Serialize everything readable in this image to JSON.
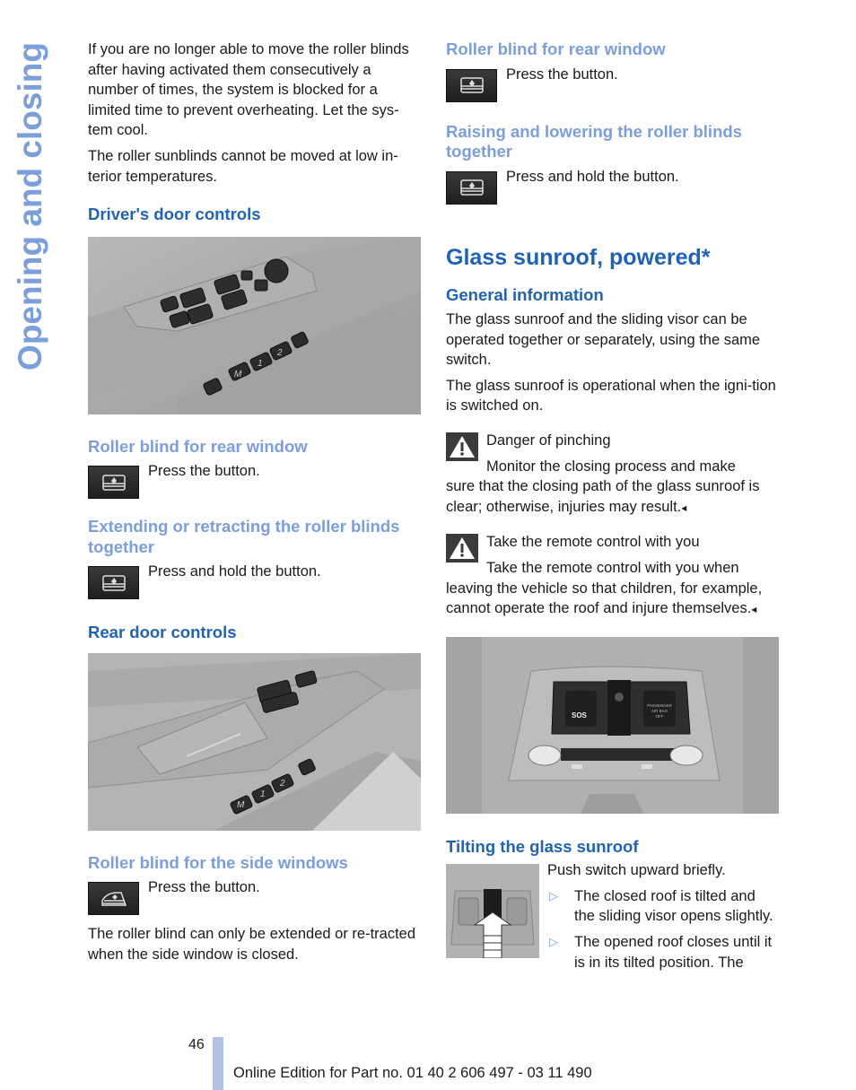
{
  "sidebar": {
    "chapter_title": "Opening and closing"
  },
  "left_column": {
    "intro_paragraphs": [
      "If you are no longer able to move the roller blinds after having activated them consecutively a number of times, the system is blocked for a limited time to prevent overheating. Let the sys-tem cool.",
      "The roller sunblinds cannot be moved at low in-terior temperatures."
    ],
    "drivers_door": {
      "heading": "Driver's door controls",
      "figure_alt": "Driver's door control panel with window switches, mirror adjuster and seat memory buttons",
      "figure_labels": [
        "M",
        "1",
        "2"
      ]
    },
    "rear_window_blind": {
      "heading": "Roller blind for rear window",
      "instruction": "Press the button.",
      "icon": "rear-window-blind-icon"
    },
    "extend_retract": {
      "heading": "Extending or retracting the roller blinds together",
      "instruction": "Press and hold the button.",
      "icon": "rear-window-blind-icon"
    },
    "rear_door": {
      "heading": "Rear door controls",
      "figure_alt": "Rear door control panel with window switches and seat memory buttons",
      "figure_labels": [
        "M",
        "1",
        "2"
      ]
    },
    "side_windows_blind": {
      "heading": "Roller blind for the side windows",
      "instruction": "Press the button.",
      "icon": "side-window-blind-icon",
      "note": "The roller blind can only be extended or re-tracted when the side window is closed."
    }
  },
  "right_column": {
    "rear_window_blind": {
      "heading": "Roller blind for rear window",
      "instruction": "Press the button.",
      "icon": "rear-window-blind-icon"
    },
    "raise_lower": {
      "heading": "Raising and lowering the roller blinds together",
      "instruction": "Press and hold the button.",
      "icon": "rear-window-blind-icon"
    },
    "section_title": "Glass sunroof, powered*",
    "general_info": {
      "heading": "General information",
      "paragraphs": [
        "The glass sunroof and the sliding visor can be operated together or separately, using the same switch.",
        "The glass sunroof is operational when the igni-tion is switched on."
      ]
    },
    "warnings": [
      {
        "icon": "warning-triangle-icon",
        "title": "Danger of pinching",
        "first_line": "Monitor the closing process and make",
        "rest": "sure that the closing path of the glass sunroof is clear; otherwise, injuries may result.",
        "end_mark": "◂"
      },
      {
        "icon": "warning-triangle-icon",
        "title": "Take the remote control with you",
        "first_line": "Take the remote control with you when",
        "rest": "leaving the vehicle so that children, for example, cannot operate the roof and injure themselves.",
        "end_mark": "◂"
      }
    ],
    "overhead_figure": {
      "figure_alt": "Overhead console with SOS button, sunroof switch and passenger airbag off indicator",
      "sos_label": "SOS",
      "airbag_label_lines": [
        "PASSENGER",
        "AIR BAG",
        "OFF"
      ]
    },
    "tilting": {
      "heading": "Tilting the glass sunroof",
      "intro": "Push switch upward briefly.",
      "bullet_glyph": "▷",
      "bullets": [
        "The closed roof is tilted and the sliding visor opens slightly.",
        "The opened roof closes until it is in its tilted position. The"
      ]
    }
  },
  "footer": {
    "page_number": "46",
    "edition_text": "Online Edition for Part no. 01 40 2 606 497 - 03 11 490"
  },
  "colors": {
    "heading_blue": "#1f63b8",
    "subheading_light_blue": "#7b9edd",
    "sidebar_blue": "#7a9fdc",
    "footer_bar": "#b0c0e4"
  }
}
